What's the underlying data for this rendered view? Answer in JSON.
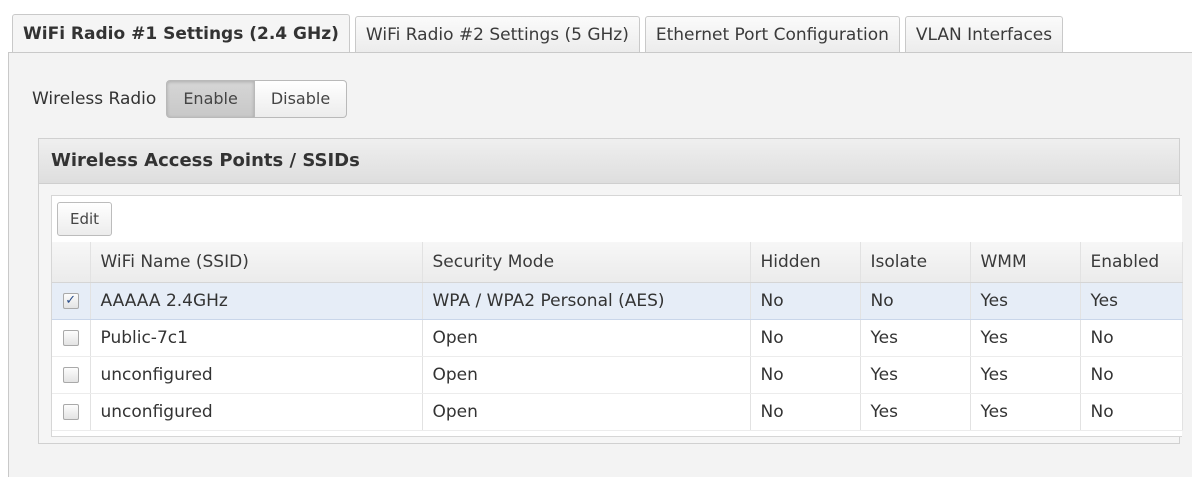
{
  "tabs": [
    {
      "label": "WiFi Radio #1 Settings (2.4 GHz)",
      "active": true
    },
    {
      "label": "WiFi Radio #2 Settings (5 GHz)",
      "active": false
    },
    {
      "label": "Ethernet Port Configuration",
      "active": false
    },
    {
      "label": "VLAN Interfaces",
      "active": false
    }
  ],
  "radio": {
    "label": "Wireless Radio",
    "enable_label": "Enable",
    "disable_label": "Disable",
    "selected": "Enable"
  },
  "section": {
    "title": "Wireless Access Points / SSIDs",
    "edit_label": "Edit"
  },
  "table": {
    "columns": [
      "",
      "WiFi Name (SSID)",
      "Security Mode",
      "Hidden",
      "Isolate",
      "WMM",
      "Enabled"
    ],
    "rows": [
      {
        "checked": true,
        "ssid": "AAAAA 2.4GHz",
        "security": "WPA / WPA2 Personal (AES)",
        "hidden": "No",
        "isolate": "No",
        "wmm": "Yes",
        "enabled": "Yes"
      },
      {
        "checked": false,
        "ssid": "Public-7c1",
        "security": "Open",
        "hidden": "No",
        "isolate": "Yes",
        "wmm": "Yes",
        "enabled": "No"
      },
      {
        "checked": false,
        "ssid": "unconfigured",
        "security": "Open",
        "hidden": "No",
        "isolate": "Yes",
        "wmm": "Yes",
        "enabled": "No"
      },
      {
        "checked": false,
        "ssid": "unconfigured",
        "security": "Open",
        "hidden": "No",
        "isolate": "Yes",
        "wmm": "Yes",
        "enabled": "No"
      }
    ]
  },
  "icons": {
    "checkbox_checked": "checkmark-icon"
  }
}
